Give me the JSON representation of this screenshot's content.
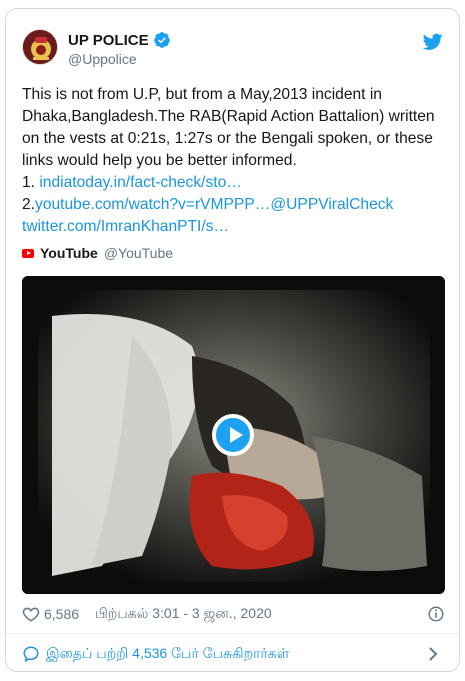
{
  "tweet": {
    "author_name": "UP POLICE",
    "author_handle": "@Uppolice",
    "text_main": "This is not from U.P, but from a May,2013 incident in Dhaka,Bangladesh.The RAB(Rapid Action Battalion) written on the vests at 0:21s, 1:27s or the Bengali spoken, or these links would help you be better informed.",
    "link1_prefix": "1. ",
    "link1": "indiatoday.in/fact-check/sto…",
    "link2_prefix": "2.",
    "link2": "youtube.com/watch?v=rVMPPP…",
    "mention": "@UPPViralCheck",
    "link3": "twitter.com/ImranKhanPTI/s…"
  },
  "embed": {
    "source_name": "YouTube",
    "source_handle": "@YouTube",
    "icon": "youtube-logo-icon"
  },
  "video": {
    "play_icon": "play-icon"
  },
  "meta": {
    "likes": "6,586",
    "timestamp": "பிற்பகல் 3:01 - 3 ஜன., 2020"
  },
  "footer": {
    "conversation_text": "இதைப் பற்றி 4,536 பேர் பேசுகிறார்கள்"
  },
  "colors": {
    "link": "#1b95e0",
    "twitter_blue": "#1da1f2",
    "muted": "#657786",
    "youtube_red": "#ff0000"
  }
}
